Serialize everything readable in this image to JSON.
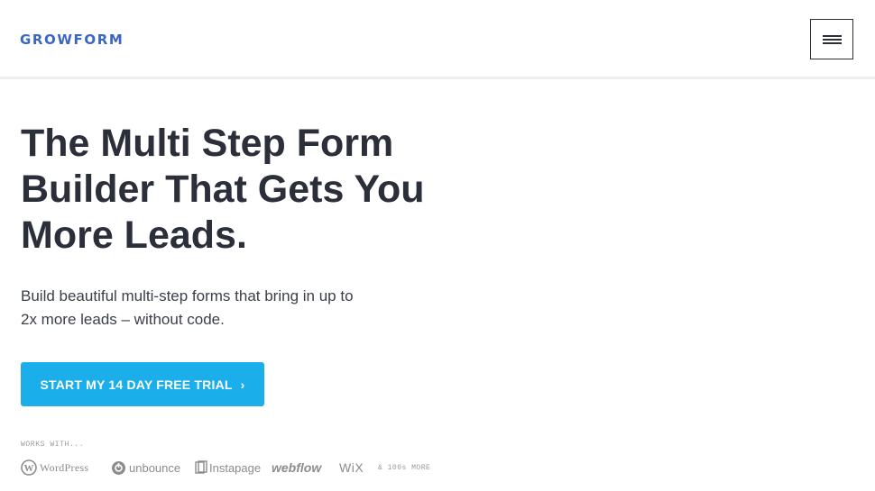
{
  "header": {
    "logo_text": "GROWFORM",
    "menu_icon": "hamburger-menu-icon"
  },
  "hero": {
    "headline_lines": [
      "The Multi Step Form",
      "Builder That Gets You",
      "More Leads."
    ],
    "subtitle_lines": [
      "Build beautiful multi-step forms that bring in up to",
      "2x more leads – without code."
    ],
    "cta_label": "START MY 14 DAY FREE TRIAL",
    "cta_chevron": "›"
  },
  "integrations": {
    "label": "WORKS WITH...",
    "logos": [
      "WordPress",
      "unbounce",
      "Instapage",
      "webflow",
      "WiX"
    ],
    "more_text": "& 100s MORE"
  },
  "colors": {
    "brand_blue": "#3b66c4",
    "cta_background": "#1aaeea",
    "headline_text": "#2b2f3a"
  }
}
